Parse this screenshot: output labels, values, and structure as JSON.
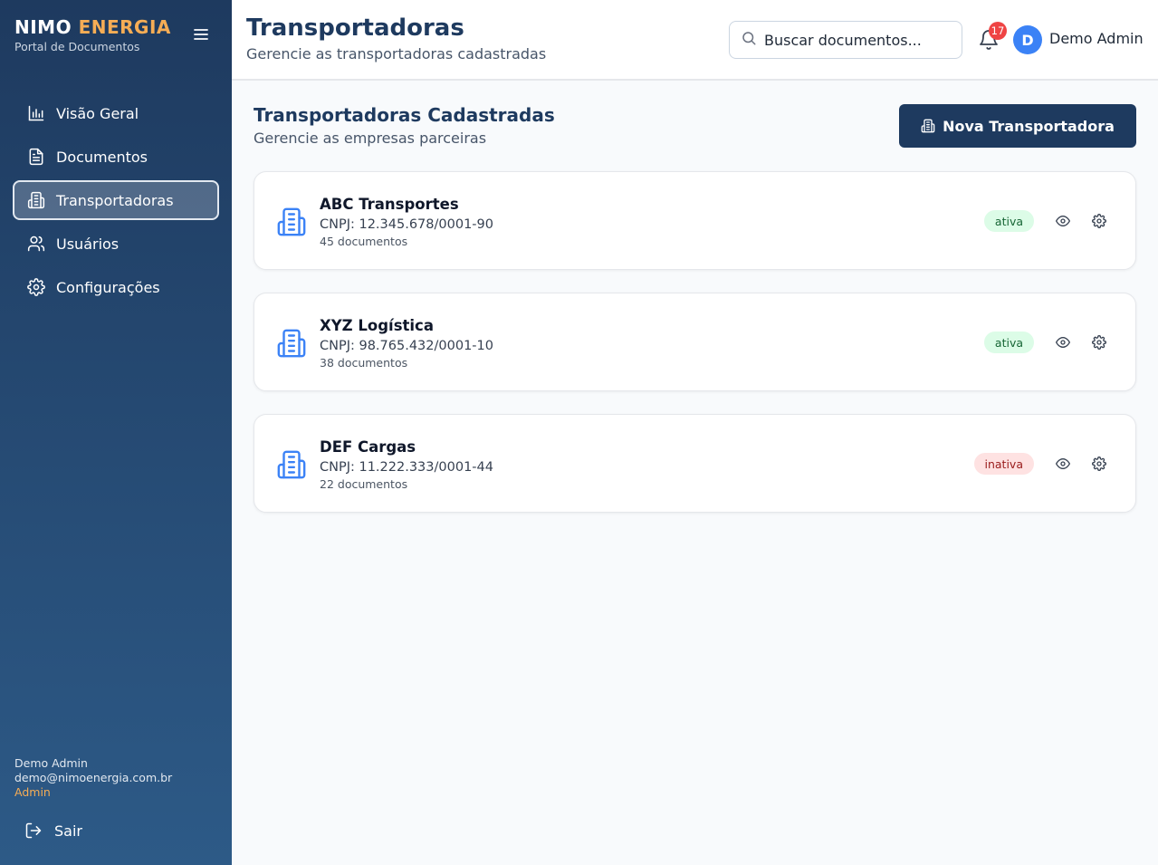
{
  "brand": {
    "name_part1": "NIMO",
    "name_part2": "ENERGIA",
    "subtitle": "Portal de Documentos"
  },
  "sidebar": {
    "items": [
      {
        "label": "Visão Geral",
        "icon": "bar-chart-icon",
        "active": false
      },
      {
        "label": "Documentos",
        "icon": "file-text-icon",
        "active": false
      },
      {
        "label": "Transportadoras",
        "icon": "building-icon",
        "active": true
      },
      {
        "label": "Usuários",
        "icon": "users-icon",
        "active": false
      },
      {
        "label": "Configurações",
        "icon": "gear-icon",
        "active": false
      }
    ],
    "user": {
      "name": "Demo Admin",
      "email": "demo@nimoenergia.com.br",
      "role": "Admin"
    },
    "logout_label": "Sair"
  },
  "header": {
    "title": "Transportadoras",
    "subtitle": "Gerencie as transportadoras cadastradas",
    "search_placeholder": "Buscar documentos...",
    "notification_count": "17",
    "avatar_initial": "D",
    "user_name": "Demo Admin"
  },
  "main": {
    "section_title": "Transportadoras Cadastradas",
    "section_subtitle": "Gerencie as empresas parceiras",
    "new_button_label": "Nova Transportadora",
    "carriers": [
      {
        "name": "ABC Transportes",
        "cnpj": "CNPJ: 12.345.678/0001-90",
        "docs": "45 documentos",
        "status": "ativa"
      },
      {
        "name": "XYZ Logística",
        "cnpj": "CNPJ: 98.765.432/0001-10",
        "docs": "38 documentos",
        "status": "ativa"
      },
      {
        "name": "DEF Cargas",
        "cnpj": "CNPJ: 11.222.333/0001-44",
        "docs": "22 documentos",
        "status": "inativa"
      }
    ]
  },
  "colors": {
    "sidebar_top": "#1e3a5f",
    "sidebar_bottom": "#2d5a87",
    "accent": "#f6ad55",
    "primary": "#1e3a5f",
    "icon_blue": "#3b82f6",
    "badge_red": "#ef4444"
  }
}
